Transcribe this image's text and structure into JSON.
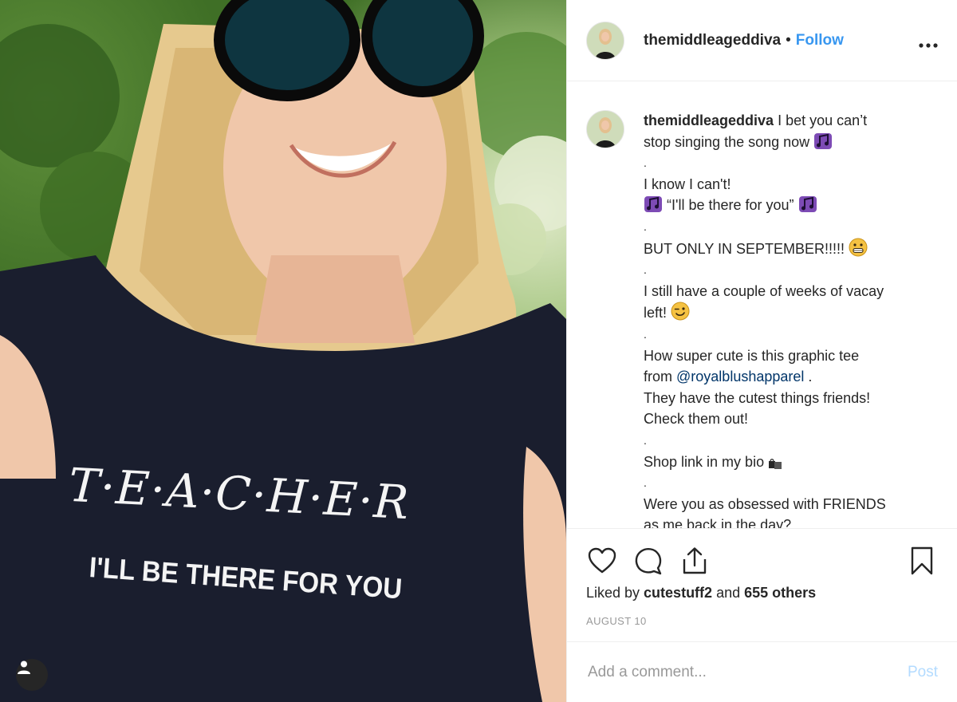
{
  "post": {
    "username": "themiddleageddiva",
    "separator": "•",
    "follow_label": "Follow",
    "more_label": "•••"
  },
  "photo": {
    "shirt_logo": "T·E·A·C·H·E·R",
    "shirt_tagline": "I'LL BE THERE FOR YOU"
  },
  "caption": {
    "username": "themiddleageddiva",
    "lines": [
      "I bet you can’t",
      "stop singing the song now",
      ".",
      "I know I can't!",
      "“I'll be there for you”",
      ".",
      "BUT ONLY IN SEPTEMBER!!!!!",
      ".",
      "I still have a couple of weeks of vacay",
      "left!",
      ".",
      "How super cute is this graphic tee",
      "from ",
      "@royalblushapparel",
      " .",
      "They have the cutest things friends!",
      "Check them out!",
      ".",
      "Shop link in my bio",
      ".",
      "Were you as obsessed with FRIENDS",
      "as me back in the day?"
    ]
  },
  "actions": {
    "liked_by_prefix": "Liked by ",
    "liked_by_user": "cutestuff2",
    "liked_by_suffix": " and ",
    "liked_by_count": "655 others",
    "date": "AUGUST 10"
  },
  "comment_box": {
    "placeholder": "Add a comment...",
    "post_label": "Post"
  },
  "icons": {
    "like": "heart-icon",
    "comment": "speech-bubble-icon",
    "share": "share-icon",
    "save": "bookmark-icon",
    "more": "ellipsis-icon",
    "photo_badge": "user-icon"
  },
  "colors": {
    "follow_link": "#3897f0",
    "mention_link": "#003569",
    "post_button_disabled": "#b3dbff",
    "muted_text": "#999999"
  }
}
